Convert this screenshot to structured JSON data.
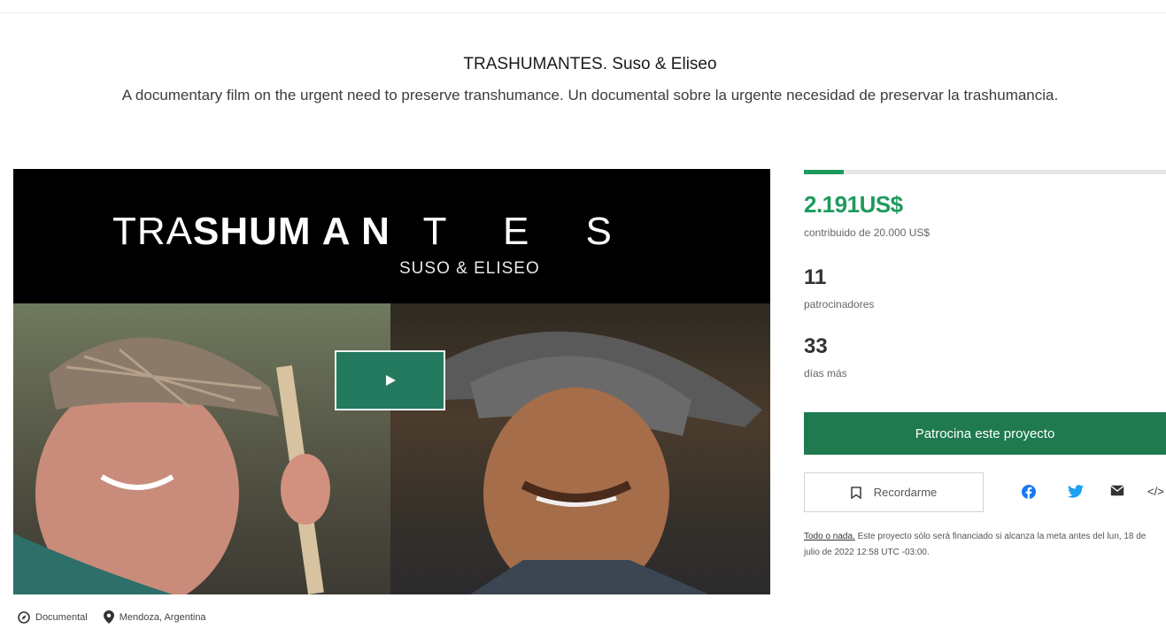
{
  "project": {
    "title": "TRASHUMANTES. Suso & Eliseo",
    "blurb": "A documentary film on the urgent need to preserve transhumance. Un documental sobre la urgente necesidad de preservar la trashumancia."
  },
  "video": {
    "brand_thin": "TRA",
    "brand_bold": "SHUM",
    "brand_bold2": "A N",
    "brand_spread": "T E S",
    "brand_sub": "SUSO & ELISEO",
    "play_icon": "play-icon"
  },
  "meta": {
    "category": "Documental",
    "location": "Mendoza, Argentina"
  },
  "stats": {
    "progress_fraction": 0.11,
    "pledged": "2.191US$",
    "pledged_sub": "contribuido de 20.000 US$",
    "backers": "11",
    "backers_label": "patrocinadores",
    "days": "33",
    "days_label": "días más"
  },
  "actions": {
    "back_label": "Patrocina este proyecto",
    "remind_label": "Recordarme",
    "embed_label": "</>"
  },
  "notice": {
    "link": "Todo o nada.",
    "text": " Este proyecto sólo será financiado si alcanza la meta antes del lun, 18 de julio de 2022 12:58 UTC -03:00."
  },
  "colors": {
    "accent": "#1e9a5c",
    "button": "#1f7a4f",
    "facebook": "#1877f2",
    "twitter": "#1da1f2"
  }
}
